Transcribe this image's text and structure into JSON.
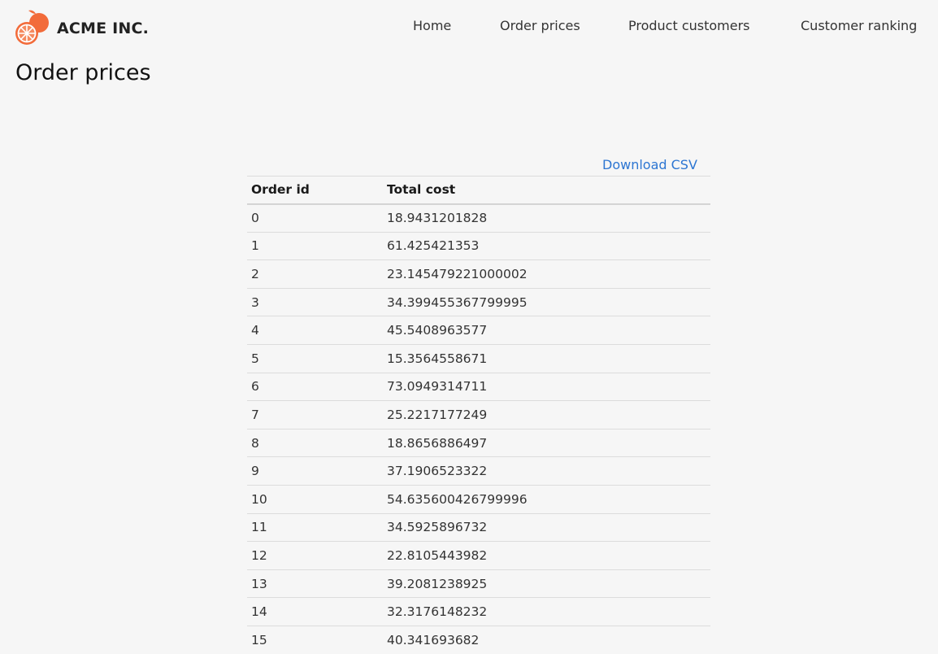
{
  "brand": {
    "name": "ACME INC.",
    "logo_icon": "orange-fruit-icon",
    "accent": "#f26b3a"
  },
  "nav": {
    "items": [
      {
        "label": "Home"
      },
      {
        "label": "Order prices"
      },
      {
        "label": "Product customers"
      },
      {
        "label": "Customer ranking"
      }
    ]
  },
  "page": {
    "title": "Order prices"
  },
  "download": {
    "label": "Download CSV",
    "color": "#2d76d2"
  },
  "table": {
    "columns": [
      "Order id",
      "Total cost"
    ],
    "rows": [
      [
        "0",
        "18.9431201828"
      ],
      [
        "1",
        "61.425421353"
      ],
      [
        "2",
        "23.145479221000002"
      ],
      [
        "3",
        "34.399455367799995"
      ],
      [
        "4",
        "45.5408963577"
      ],
      [
        "5",
        "15.3564558671"
      ],
      [
        "6",
        "73.0949314711"
      ],
      [
        "7",
        "25.2217177249"
      ],
      [
        "8",
        "18.8656886497"
      ],
      [
        "9",
        "37.1906523322"
      ],
      [
        "10",
        "54.635600426799996"
      ],
      [
        "11",
        "34.5925896732"
      ],
      [
        "12",
        "22.8105443982"
      ],
      [
        "13",
        "39.2081238925"
      ],
      [
        "14",
        "32.3176148232"
      ],
      [
        "15",
        "40.341693682"
      ]
    ]
  }
}
